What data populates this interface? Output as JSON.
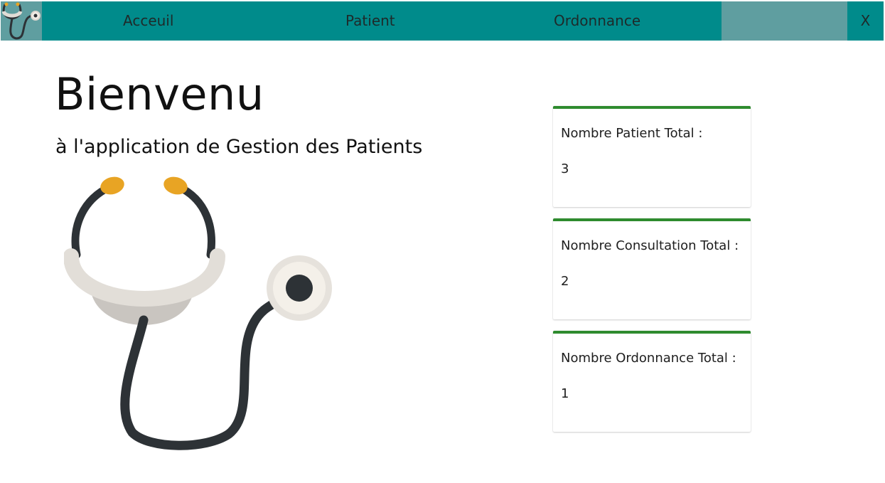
{
  "nav": {
    "logo_icon": "stethoscope-icon",
    "items": [
      {
        "label": "Acceuil"
      },
      {
        "label": "Patient"
      },
      {
        "label": "Ordonnance"
      }
    ],
    "close_label": "X"
  },
  "welcome": {
    "title": "Bienvenu",
    "subtitle": "à l'application de Gestion des Patients",
    "illustration_icon": "stethoscope-icon"
  },
  "stats": [
    {
      "label": "Nombre Patient Total :",
      "value": "3"
    },
    {
      "label": "Nombre Consultation Total :",
      "value": "2"
    },
    {
      "label": "Nombre Ordonnance Total :",
      "value": "1"
    }
  ],
  "colors": {
    "navbar": "#008b8b",
    "nav_highlight": "#5f9ea0",
    "card_accent": "#2e8b2e",
    "earpiece": "#e8a424",
    "tube": "#2d3236"
  }
}
